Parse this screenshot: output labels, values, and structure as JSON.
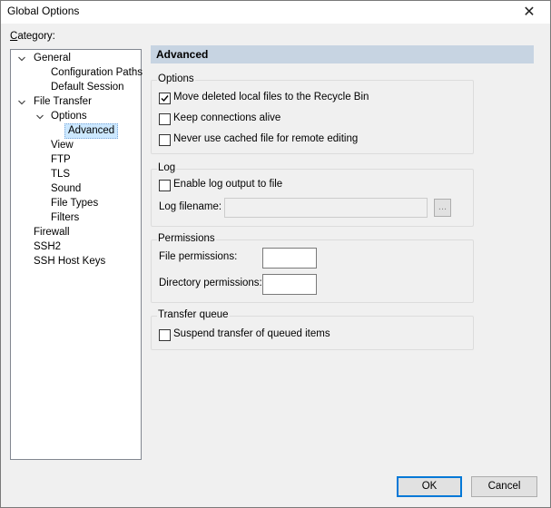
{
  "window": {
    "title": "Global Options"
  },
  "category": {
    "label": "Category:",
    "tree": [
      {
        "label": "General",
        "expanded": true
      },
      {
        "label": "Configuration Paths"
      },
      {
        "label": "Default Session"
      },
      {
        "label": "File Transfer",
        "expanded": true
      },
      {
        "label": "Options",
        "expanded": true
      },
      {
        "label": "Advanced",
        "selected": true
      },
      {
        "label": "View"
      },
      {
        "label": "FTP"
      },
      {
        "label": "TLS"
      },
      {
        "label": "Sound"
      },
      {
        "label": "File Types"
      },
      {
        "label": "Filters"
      },
      {
        "label": "Firewall"
      },
      {
        "label": "SSH2"
      },
      {
        "label": "SSH Host Keys"
      }
    ]
  },
  "panel": {
    "title": "Advanced",
    "options_group": {
      "legend": "Options",
      "move_deleted": {
        "label": "Move deleted local files to the Recycle Bin",
        "checked": true
      },
      "keep_alive": {
        "label": "Keep connections alive",
        "checked": false
      },
      "never_cached": {
        "label": "Never use cached file for remote editing",
        "checked": false
      }
    },
    "log_group": {
      "legend": "Log",
      "enable_log": {
        "label": "Enable log output to file",
        "checked": false
      },
      "filename_label": "Log filename:",
      "filename_value": "",
      "browse_label": "..."
    },
    "permissions_group": {
      "legend": "Permissions",
      "file_label": "File permissions:",
      "file_value": "",
      "directory_label": "Directory permissions:",
      "directory_value": ""
    },
    "transfer_queue_group": {
      "legend": "Transfer queue",
      "suspend": {
        "label": "Suspend transfer of queued items",
        "checked": false
      }
    }
  },
  "buttons": {
    "ok": "OK",
    "cancel": "Cancel"
  },
  "icons": {
    "close": "close-icon",
    "expand": "chevron-down-icon",
    "check": "checkmark-icon"
  },
  "colors": {
    "header_bg": "#c7d4e2",
    "selection_bg": "#cce8ff",
    "accent": "#0078d7"
  }
}
